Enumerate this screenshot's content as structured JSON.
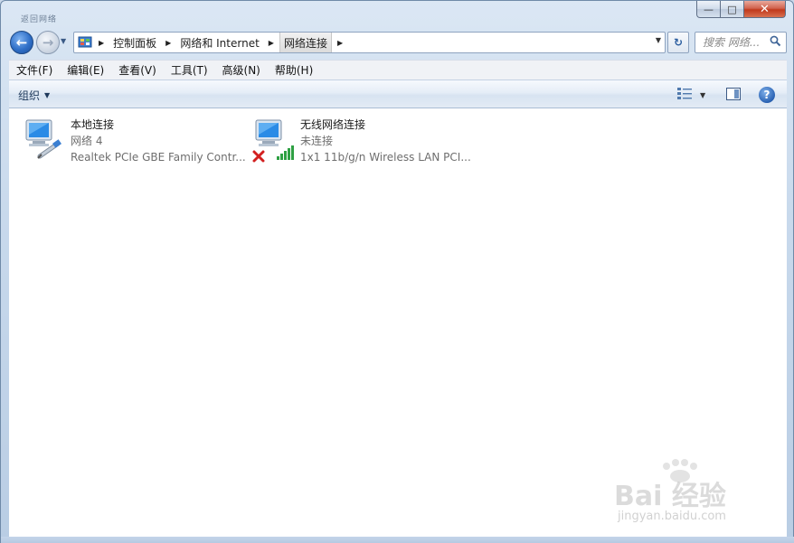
{
  "window": {
    "title_hint": "返回网络",
    "caption": {
      "minimize": "—",
      "maximize": "□",
      "close": "✕"
    }
  },
  "nav": {
    "back_glyph": "←",
    "forward_glyph": "→",
    "breadcrumbs": [
      {
        "label": "控制面板"
      },
      {
        "label": "网络和 Internet"
      },
      {
        "label": "网络连接"
      }
    ],
    "search_placeholder": "搜索 网络...",
    "refresh_glyph": "↻"
  },
  "menu": {
    "items": [
      {
        "label": "文件(F)"
      },
      {
        "label": "编辑(E)"
      },
      {
        "label": "查看(V)"
      },
      {
        "label": "工具(T)"
      },
      {
        "label": "高级(N)"
      },
      {
        "label": "帮助(H)"
      }
    ]
  },
  "toolbar": {
    "organize_label": "组织",
    "help_glyph": "?"
  },
  "connections": [
    {
      "name": "本地连接",
      "status": "网络  4",
      "device": "Realtek PCIe GBE Family Contr...",
      "icon": "wired-network-icon"
    },
    {
      "name": "无线网络连接",
      "status": "未连接",
      "device": "1x1 11b/g/n Wireless LAN PCI...",
      "icon": "wireless-network-icon",
      "disconnected": true
    }
  ],
  "watermark": {
    "logo_text": "Bai 经验",
    "sub_text": "jingyan.baidu.com"
  },
  "colors": {
    "accent": "#2f6fc7",
    "error": "#d21f1f",
    "signal": "#2ea043"
  }
}
